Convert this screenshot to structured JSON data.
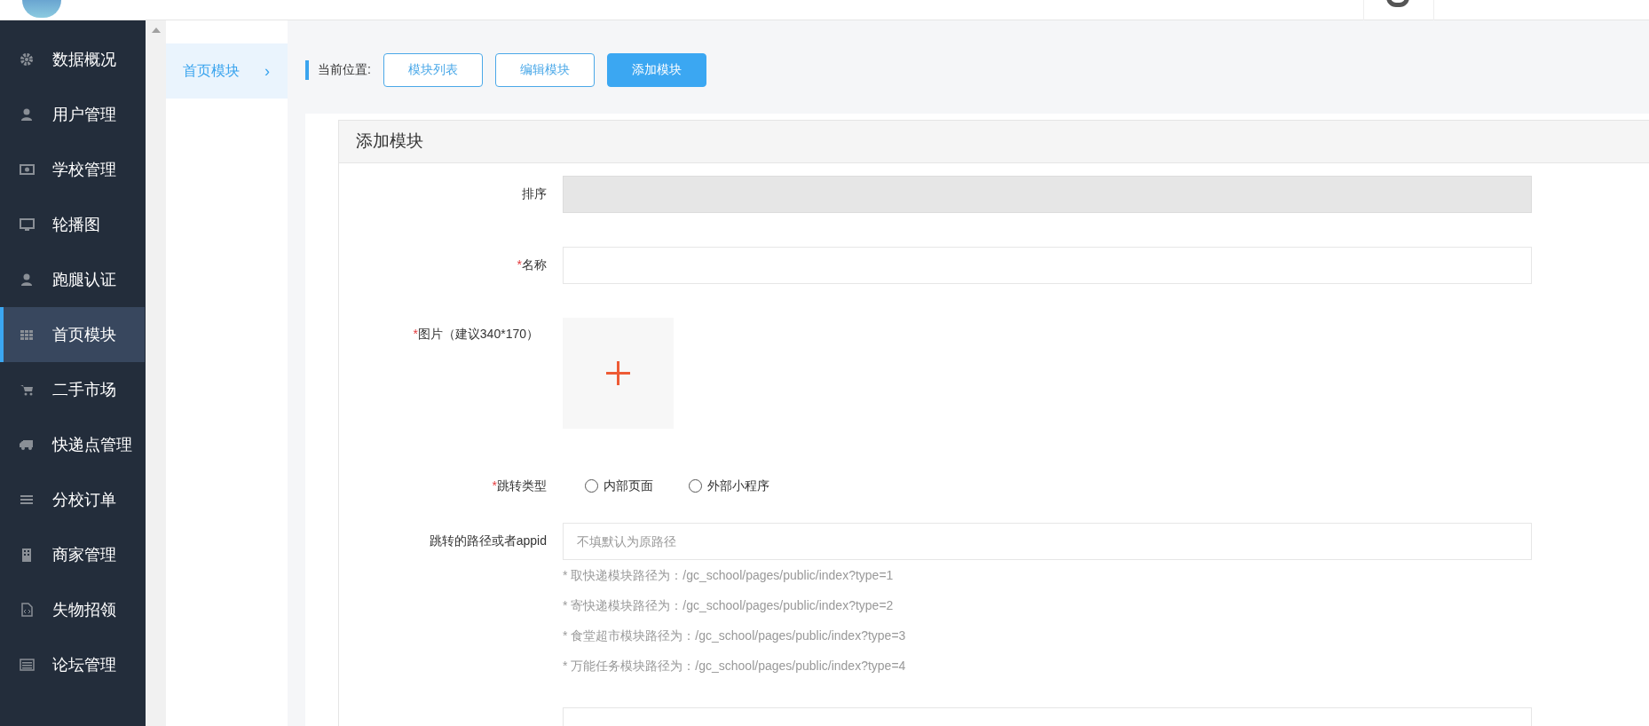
{
  "sidebar": {
    "items": [
      {
        "label": "数据概况",
        "selected": false
      },
      {
        "label": "用户管理",
        "selected": false
      },
      {
        "label": "学校管理",
        "selected": false
      },
      {
        "label": "轮播图",
        "selected": false
      },
      {
        "label": "跑腿认证",
        "selected": false
      },
      {
        "label": "首页模块",
        "selected": true
      },
      {
        "label": "二手市场",
        "selected": false
      },
      {
        "label": "快递点管理",
        "selected": false
      },
      {
        "label": "分校订单",
        "selected": false
      },
      {
        "label": "商家管理",
        "selected": false
      },
      {
        "label": "失物招领",
        "selected": false
      },
      {
        "label": "论坛管理",
        "selected": false
      }
    ]
  },
  "submenu": {
    "items": [
      {
        "label": "首页模块",
        "selected": true,
        "arrow": "›"
      }
    ]
  },
  "breadcrumb": {
    "label": "当前位置:",
    "buttons": [
      {
        "label": "模块列表",
        "selected": false
      },
      {
        "label": "编辑模块",
        "selected": false
      },
      {
        "label": "添加模块",
        "selected": true
      }
    ]
  },
  "form": {
    "title": "添加模块",
    "fields": [
      {
        "kind": "input",
        "label": "排序",
        "disabled": true
      },
      {
        "kind": "input",
        "marker": "*",
        "label": "名称",
        "disabled": false
      },
      {
        "kind": "upload",
        "marker": "*",
        "label": "图片（建议340*170）"
      },
      {
        "kind": "radio",
        "marker": "*",
        "label": "跳转类型",
        "options": [
          {
            "label": "内部页面",
            "selected": false
          },
          {
            "label": "外部小程序",
            "selected": false
          }
        ]
      },
      {
        "kind": "input",
        "label": "跳转的路径或者appid",
        "disabled": false,
        "placeholder": "不填默认为原路径",
        "hints": [
          "* 取快递模块路径为：/gc_school/pages/public/index?type=1",
          "* 寄快递模块路径为：/gc_school/pages/public/index?type=2",
          "* 食堂超市模块路径为：/gc_school/pages/public/index?type=3",
          "* 万能任务模块路径为：/gc_school/pages/public/index?type=4"
        ]
      },
      {
        "kind": "partial"
      }
    ]
  }
}
